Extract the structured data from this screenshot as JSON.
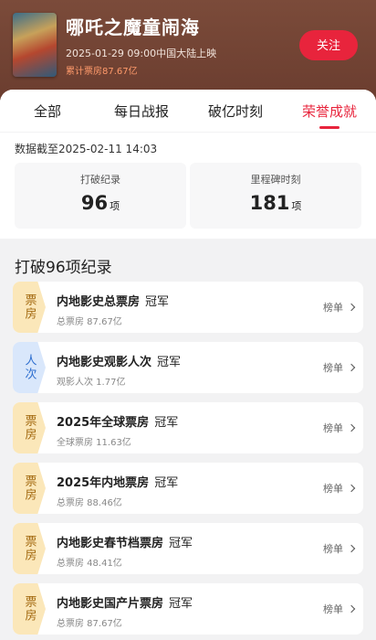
{
  "movie": {
    "title": "哪吒之魔童闹海",
    "release": "2025-01-29 09:00中国大陆上映",
    "box_total": "累计票房87.67亿",
    "follow_label": "关注"
  },
  "tabs": [
    {
      "label": "全部",
      "active": false
    },
    {
      "label": "每日战报",
      "active": false
    },
    {
      "label": "破亿时刻",
      "active": false
    },
    {
      "label": "荣誉成就",
      "active": true
    }
  ],
  "summary": {
    "cutoff": "数据截至2025-02-11  14:03",
    "stats": [
      {
        "label": "打破纪录",
        "value": "96",
        "unit": "项"
      },
      {
        "label": "里程碑时刻",
        "value": "181",
        "unit": "项"
      }
    ]
  },
  "records_title": "打破96项纪录",
  "rank_label": "榜单",
  "records": [
    {
      "badge": "票房",
      "badge_color": "yellow",
      "title": "内地影史总票房",
      "tag": "冠军",
      "sub": "总票房 87.67亿"
    },
    {
      "badge": "人次",
      "badge_color": "blue",
      "title": "内地影史观影人次",
      "tag": "冠军",
      "sub": "观影人次 1.77亿"
    },
    {
      "badge": "票房",
      "badge_color": "yellow",
      "title": "2025年全球票房",
      "tag": "冠军",
      "sub": "全球票房 11.63亿"
    },
    {
      "badge": "票房",
      "badge_color": "yellow",
      "title": "2025年内地票房",
      "tag": "冠军",
      "sub": "总票房 88.46亿"
    },
    {
      "badge": "票房",
      "badge_color": "yellow",
      "title": "内地影史春节档票房",
      "tag": "冠军",
      "sub": "总票房 48.41亿"
    },
    {
      "badge": "票房",
      "badge_color": "yellow",
      "title": "内地影史国产片票房",
      "tag": "冠军",
      "sub": "总票房 87.67亿"
    }
  ]
}
